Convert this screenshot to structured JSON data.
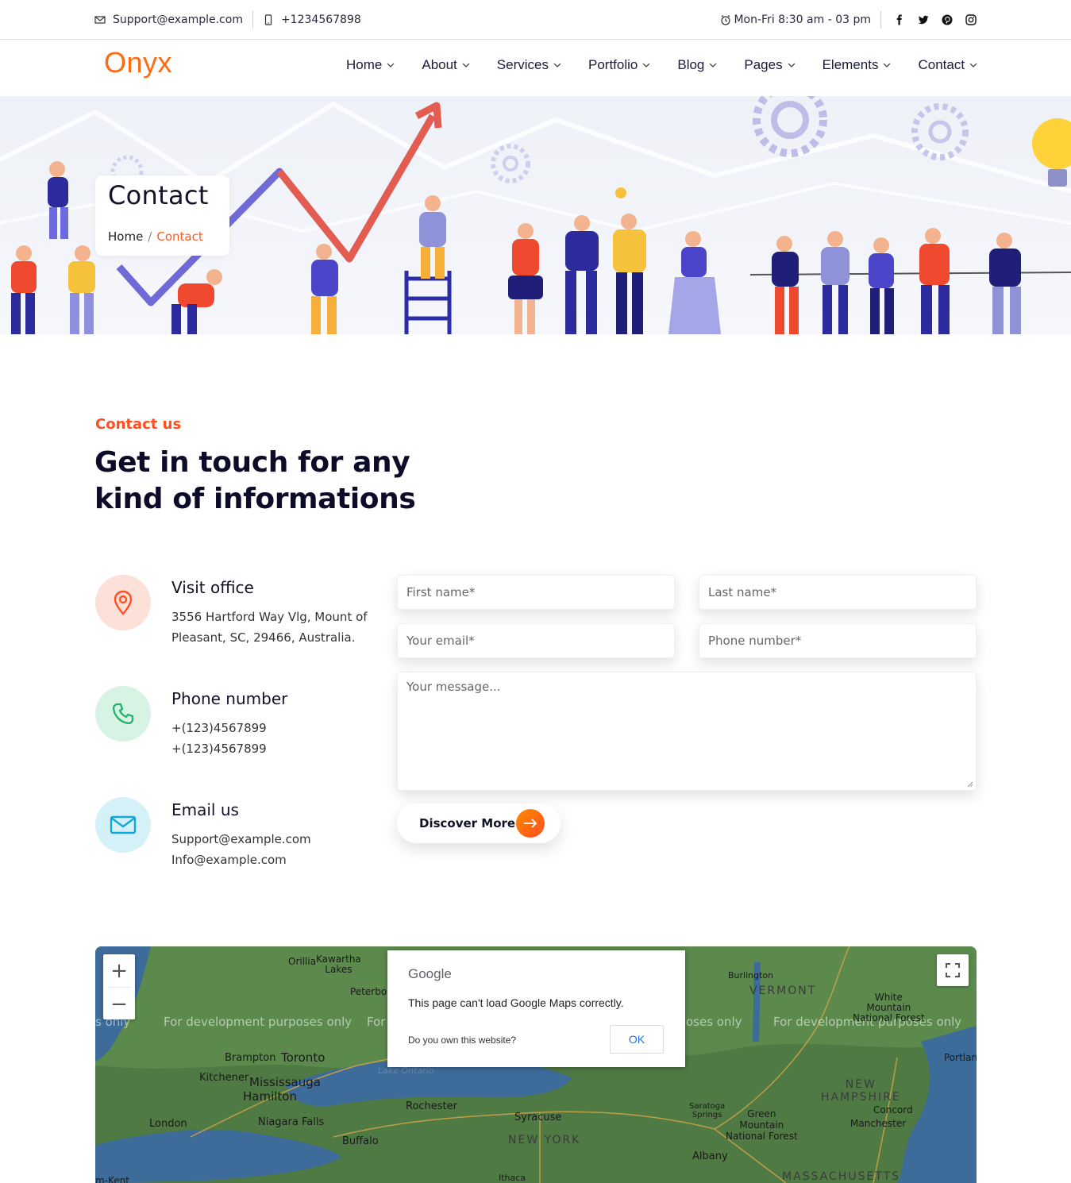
{
  "topbar": {
    "email": "Support@example.com",
    "phone": "+1234567898",
    "hours": "Mon-Fri 8:30 am - 03 pm",
    "social": [
      "facebook-icon",
      "twitter-icon",
      "pinterest-icon",
      "instagram-icon"
    ]
  },
  "brand": {
    "logo": "Onyx",
    "accent": "#ff6a13"
  },
  "nav": {
    "items": [
      {
        "label": "Home"
      },
      {
        "label": "About"
      },
      {
        "label": "Services"
      },
      {
        "label": "Portfolio"
      },
      {
        "label": "Blog"
      },
      {
        "label": "Pages"
      },
      {
        "label": "Elements"
      },
      {
        "label": "Contact"
      }
    ]
  },
  "hero": {
    "title": "Contact",
    "breadcrumb": {
      "home": "Home",
      "separator": "/",
      "current": "Contact"
    }
  },
  "section": {
    "eyebrow": "Contact us",
    "heading": "Get in touch for any kind of informations"
  },
  "info": {
    "office": {
      "title": "Visit office",
      "line1": "3556 Hartford Way Vlg, Mount of",
      "line2": "Pleasant, SC, 29466, Australia."
    },
    "phone": {
      "title": "Phone number",
      "line1": "+(123)4567899",
      "line2": "+(123)4567899"
    },
    "email": {
      "title": "Email us",
      "line1": "Support@example.com",
      "line2": "Info@example.com"
    }
  },
  "form": {
    "first_name": {
      "placeholder": "First name*",
      "value": ""
    },
    "last_name": {
      "placeholder": "Last name*",
      "value": ""
    },
    "email": {
      "placeholder": "Your email*",
      "value": ""
    },
    "phone": {
      "placeholder": "Phone number*",
      "value": ""
    },
    "message": {
      "placeholder": "Your message...",
      "value": ""
    },
    "submit_label": "Discover More"
  },
  "map": {
    "zoom_in": "+",
    "zoom_out": "−",
    "dev_text": "For development purposes only",
    "dev_fragments": [
      "s only",
      "For",
      "oses only"
    ],
    "labels": {
      "toronto": "Toronto",
      "mississauga": "Mississauga",
      "hamilton": "Hamilton",
      "brampton": "Brampton",
      "kitchener": "Kitchener",
      "london": "London",
      "niagara": "Niagara Falls",
      "buffalo": "Buffalo",
      "rochester": "Rochester",
      "syracuse": "Syracuse",
      "albany": "Albany",
      "ithaca": "Ithaca",
      "kawartha": "Kawartha\nLakes",
      "orillia": "Orillia",
      "peterborough": "Peterbor",
      "burlington": "Burlington",
      "white_mountain": "White\nMountain\nNational Forest",
      "portland": "Portland",
      "concord": "Concord",
      "manchester": "Manchester",
      "green_mountain": "Green\nMountain\nNational Forest",
      "saratoga": "Saratoga\nSprings",
      "chatham": "m-Kent",
      "lake_ontario": "Lake Ontario",
      "vermont": "VERMONT",
      "new_hampshire": "NEW\nHAMPSHIRE",
      "new_york": "NEW YORK",
      "massachusetts": "MASSACHUSETTS"
    },
    "dialog": {
      "brand": "Google",
      "message": "This page can't load Google Maps correctly.",
      "question": "Do you own this website?",
      "ok": "OK"
    }
  }
}
